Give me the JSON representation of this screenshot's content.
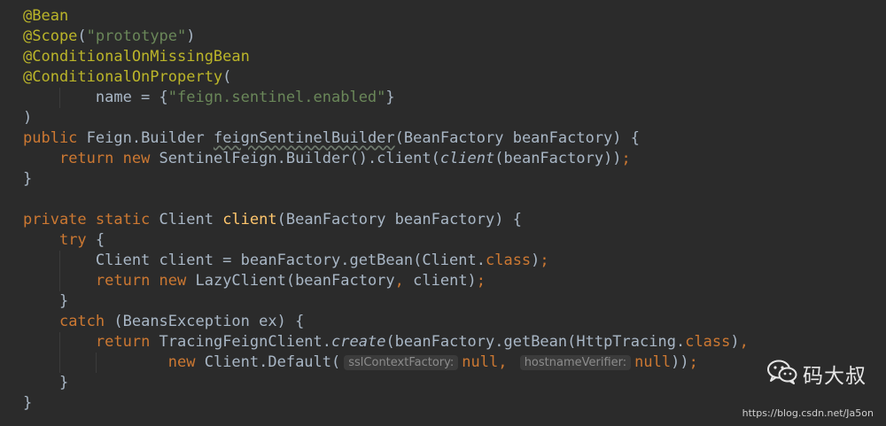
{
  "editor": {
    "lines": [
      [
        {
          "t": "ann",
          "v": "@Bean"
        }
      ],
      [
        {
          "t": "ann",
          "v": "@Scope"
        },
        {
          "t": "plain",
          "v": "("
        },
        {
          "t": "str",
          "v": "\"prototype\""
        },
        {
          "t": "plain",
          "v": ")"
        }
      ],
      [
        {
          "t": "ann",
          "v": "@ConditionalOnMissingBean"
        }
      ],
      [
        {
          "t": "ann",
          "v": "@ConditionalOnProperty"
        },
        {
          "t": "plain",
          "v": "("
        }
      ],
      [
        {
          "t": "plain",
          "v": "        name = {"
        },
        {
          "t": "str",
          "v": "\"feign.sentinel.enabled\""
        },
        {
          "t": "plain",
          "v": "}"
        }
      ],
      [
        {
          "t": "plain",
          "v": ")"
        }
      ],
      [
        {
          "t": "kw",
          "v": "public "
        },
        {
          "t": "plain",
          "v": "Feign.Builder "
        },
        {
          "t": "plain squiggle",
          "v": "feignSentinelBuilder"
        },
        {
          "t": "plain",
          "v": "(BeanFactory beanFactory) {"
        }
      ],
      [
        {
          "t": "plain",
          "v": "    "
        },
        {
          "t": "kw",
          "v": "return new "
        },
        {
          "t": "plain",
          "v": "SentinelFeign.Builder().client("
        },
        {
          "t": "plain italic",
          "v": "client"
        },
        {
          "t": "plain",
          "v": "(beanFactory))"
        },
        {
          "t": "kw",
          "v": ";"
        }
      ],
      [
        {
          "t": "plain",
          "v": "}"
        }
      ],
      [],
      [
        {
          "t": "kw",
          "v": "private static "
        },
        {
          "t": "plain",
          "v": "Client "
        },
        {
          "t": "fn",
          "v": "client"
        },
        {
          "t": "plain",
          "v": "(BeanFactory beanFactory) {"
        }
      ],
      [
        {
          "t": "plain",
          "v": "    "
        },
        {
          "t": "kw",
          "v": "try "
        },
        {
          "t": "plain",
          "v": "{"
        }
      ],
      [
        {
          "t": "plain",
          "v": "        Client client = beanFactory.getBean(Client."
        },
        {
          "t": "kw",
          "v": "class"
        },
        {
          "t": "plain",
          "v": ")"
        },
        {
          "t": "kw",
          "v": ";"
        }
      ],
      [
        {
          "t": "plain",
          "v": "        "
        },
        {
          "t": "kw",
          "v": "return new "
        },
        {
          "t": "plain",
          "v": "LazyClient(beanFactory"
        },
        {
          "t": "kw",
          "v": ", "
        },
        {
          "t": "plain",
          "v": "client)"
        },
        {
          "t": "kw",
          "v": ";"
        }
      ],
      [
        {
          "t": "plain",
          "v": "    }"
        }
      ],
      [
        {
          "t": "plain",
          "v": "    "
        },
        {
          "t": "kw",
          "v": "catch "
        },
        {
          "t": "plain",
          "v": "(BeansException ex) {"
        }
      ],
      [
        {
          "t": "plain",
          "v": "        "
        },
        {
          "t": "kw",
          "v": "return "
        },
        {
          "t": "plain",
          "v": "TracingFeignClient."
        },
        {
          "t": "plain italic",
          "v": "create"
        },
        {
          "t": "plain",
          "v": "(beanFactory.getBean(HttpTracing."
        },
        {
          "t": "kw",
          "v": "class"
        },
        {
          "t": "plain",
          "v": ")"
        },
        {
          "t": "kw",
          "v": ","
        }
      ],
      [
        {
          "t": "plain",
          "v": "                "
        },
        {
          "t": "kw",
          "v": "new "
        },
        {
          "t": "plain",
          "v": "Client.Default("
        },
        {
          "t": "hint",
          "v": "sslContextFactory:"
        },
        {
          "t": "kw",
          "v": "null, "
        },
        {
          "t": "hint",
          "v": "hostnameVerifier:"
        },
        {
          "t": "kw",
          "v": "null"
        },
        {
          "t": "plain",
          "v": "))"
        },
        {
          "t": "kw",
          "v": ";"
        }
      ],
      [
        {
          "t": "plain",
          "v": "    }"
        }
      ],
      [
        {
          "t": "plain",
          "v": "}"
        }
      ]
    ]
  },
  "watermark": {
    "icon": "wechat-icon",
    "name": "码大叔",
    "url": "https://blog.csdn.net/Ja5on"
  },
  "colors": {
    "background": "#2b2b2b",
    "annotation": "#bbb529",
    "keyword": "#cc7832",
    "string": "#6a8759",
    "method": "#ffc66d",
    "text": "#a9b7c6"
  }
}
